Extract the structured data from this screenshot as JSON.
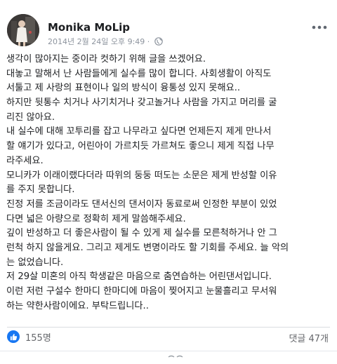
{
  "post": {
    "author": "Monika MoLip",
    "timestamp": "2014년 2월 24일 오후 9:49 ·",
    "privacy_icon": "globe-icon",
    "more_icon": "more-horizontal-icon",
    "body_lines": [
      "생각이 많아지는 중이라 컷하기 위해 글을 쓰겠어요.",
      "대놓고 말해서 난 사람들에게 실수를 많이 합니다. 사회생활이 아직도",
      "서툴고 제 사랑의 표현이나 일의 방식이 융통성 있지 못해요..",
      "하지만 뒷통수 치거나 사기치거나 갖고놀거나 사람을 가지고 머리를 굴",
      "리진 않아요.",
      "내 실수에 대해 꼬투리를 잡고 나무라고 싶다면 언제든지 제게 만나서",
      "할 얘기가 있다고, 어린아이 가르치듯 가르쳐도 좋으니 제게 직접 나무",
      "라주세요.",
      "모니카가 이래이랬다더라 따위의 둥둥 떠도는 소문은 제게 반성할 이유",
      "를 주지 못합니다.",
      "진정 저를 조금이라도 댄서신의 댄서이자 동료로써 인정한 부분이 있었",
      "다면 넓은 아량으로 정확히 제게 말씀해주세요.",
      "깊이 반성하고 더 좋은사람이 될 수 있게 제 실수를 모른척하거나 안 그",
      "런척 하지 않을게요. 그리고 제게도 변명이라도 할 기회를 주세요. 늘 악의",
      "는 없었습니다.",
      "저 29살 미혼의 아직 학생같은 마음으로 춤연습하는 어린댄서입니다.",
      "이런 저런 구설수 한마디 한마디에 마음이 찢어지고 눈물흘리고 무서워",
      "하는 약한사람이에요. 부탁드립니다.."
    ]
  },
  "reactions": {
    "icon": "like-icon",
    "color": "#1877f2",
    "count": "155명"
  },
  "comments": {
    "label": "댓글 47개"
  }
}
